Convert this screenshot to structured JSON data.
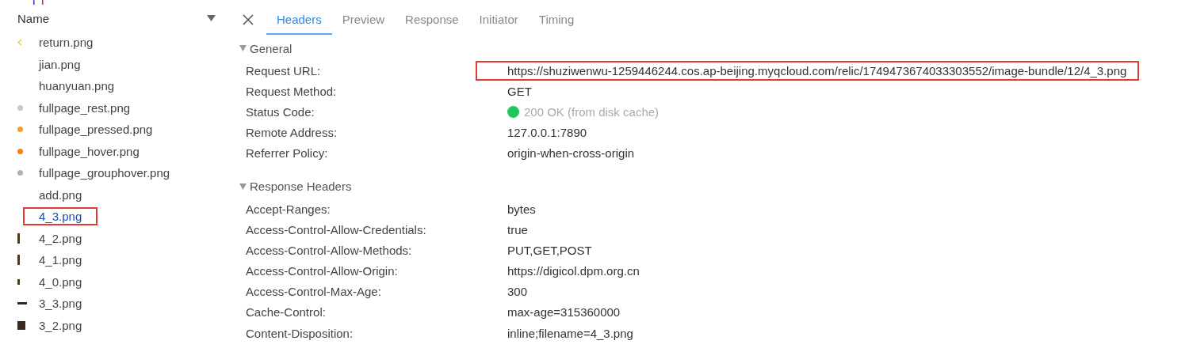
{
  "file_list": {
    "column": "Name",
    "files": [
      {
        "name": "return.png",
        "selected": false,
        "kind": "chevron",
        "color": "#e8c840"
      },
      {
        "name": "jian.png",
        "selected": false,
        "kind": "plain"
      },
      {
        "name": "huanyuan.png",
        "selected": false,
        "kind": "plain"
      },
      {
        "name": "fullpage_rest.png",
        "selected": false,
        "kind": "dot",
        "color": "#c8c8c8"
      },
      {
        "name": "fullpage_pressed.png",
        "selected": false,
        "kind": "dot",
        "color": "#f0a030"
      },
      {
        "name": "fullpage_hover.png",
        "selected": false,
        "kind": "dot",
        "color": "#f08020"
      },
      {
        "name": "fullpage_grouphover.png",
        "selected": false,
        "kind": "dot",
        "color": "#b0b0b0"
      },
      {
        "name": "add.png",
        "selected": false,
        "kind": "plain"
      },
      {
        "name": "4_3.png",
        "selected": true,
        "kind": "plain"
      },
      {
        "name": "4_2.png",
        "selected": false,
        "kind": "bar",
        "color": "#4a3a20"
      },
      {
        "name": "4_1.png",
        "selected": false,
        "kind": "bar",
        "color": "#4a3a20"
      },
      {
        "name": "4_0.png",
        "selected": false,
        "kind": "stub",
        "color": "#4a3a20"
      },
      {
        "name": "3_3.png",
        "selected": false,
        "kind": "dash",
        "color": "#2a2a2a"
      },
      {
        "name": "3_2.png",
        "selected": false,
        "kind": "block",
        "color": "#3a2a20"
      }
    ]
  },
  "tabs": [
    {
      "label": "Headers",
      "selected": true
    },
    {
      "label": "Preview",
      "selected": false
    },
    {
      "label": "Response",
      "selected": false
    },
    {
      "label": "Initiator",
      "selected": false
    },
    {
      "label": "Timing",
      "selected": false
    }
  ],
  "sections": [
    {
      "title": "General",
      "expanded": true,
      "rows": [
        {
          "name": "Request URL:",
          "value": "https://shuziwenwu-1259446244.cos.ap-beijing.myqcloud.com/relic/1749473674033303552/image-bundle/12/4_3.png",
          "highlighted": true,
          "kind": "text"
        },
        {
          "name": "Request Method:",
          "value": "GET",
          "highlighted": false,
          "kind": "text"
        },
        {
          "name": "Status Code:",
          "value": "200 OK (from disk cache)",
          "highlighted": false,
          "kind": "status",
          "color": "#22c55e"
        },
        {
          "name": "Remote Address:",
          "value": "127.0.0.1:7890",
          "highlighted": false,
          "kind": "text"
        },
        {
          "name": "Referrer Policy:",
          "value": "origin-when-cross-origin",
          "highlighted": false,
          "kind": "text"
        }
      ]
    },
    {
      "title": "Response Headers",
      "expanded": true,
      "rows": [
        {
          "name": "Accept-Ranges:",
          "value": "bytes",
          "highlighted": false,
          "kind": "text"
        },
        {
          "name": "Access-Control-Allow-Credentials:",
          "value": "true",
          "highlighted": false,
          "kind": "text"
        },
        {
          "name": "Access-Control-Allow-Methods:",
          "value": "PUT,GET,POST",
          "highlighted": false,
          "kind": "text"
        },
        {
          "name": "Access-Control-Allow-Origin:",
          "value": "https://digicol.dpm.org.cn",
          "highlighted": false,
          "kind": "text"
        },
        {
          "name": "Access-Control-Max-Age:",
          "value": "300",
          "highlighted": false,
          "kind": "text"
        },
        {
          "name": "Cache-Control:",
          "value": "max-age=315360000",
          "highlighted": false,
          "kind": "text"
        },
        {
          "name": "Content-Disposition:",
          "value": "inline;filename=4_3.png",
          "highlighted": false,
          "kind": "text"
        }
      ]
    }
  ]
}
